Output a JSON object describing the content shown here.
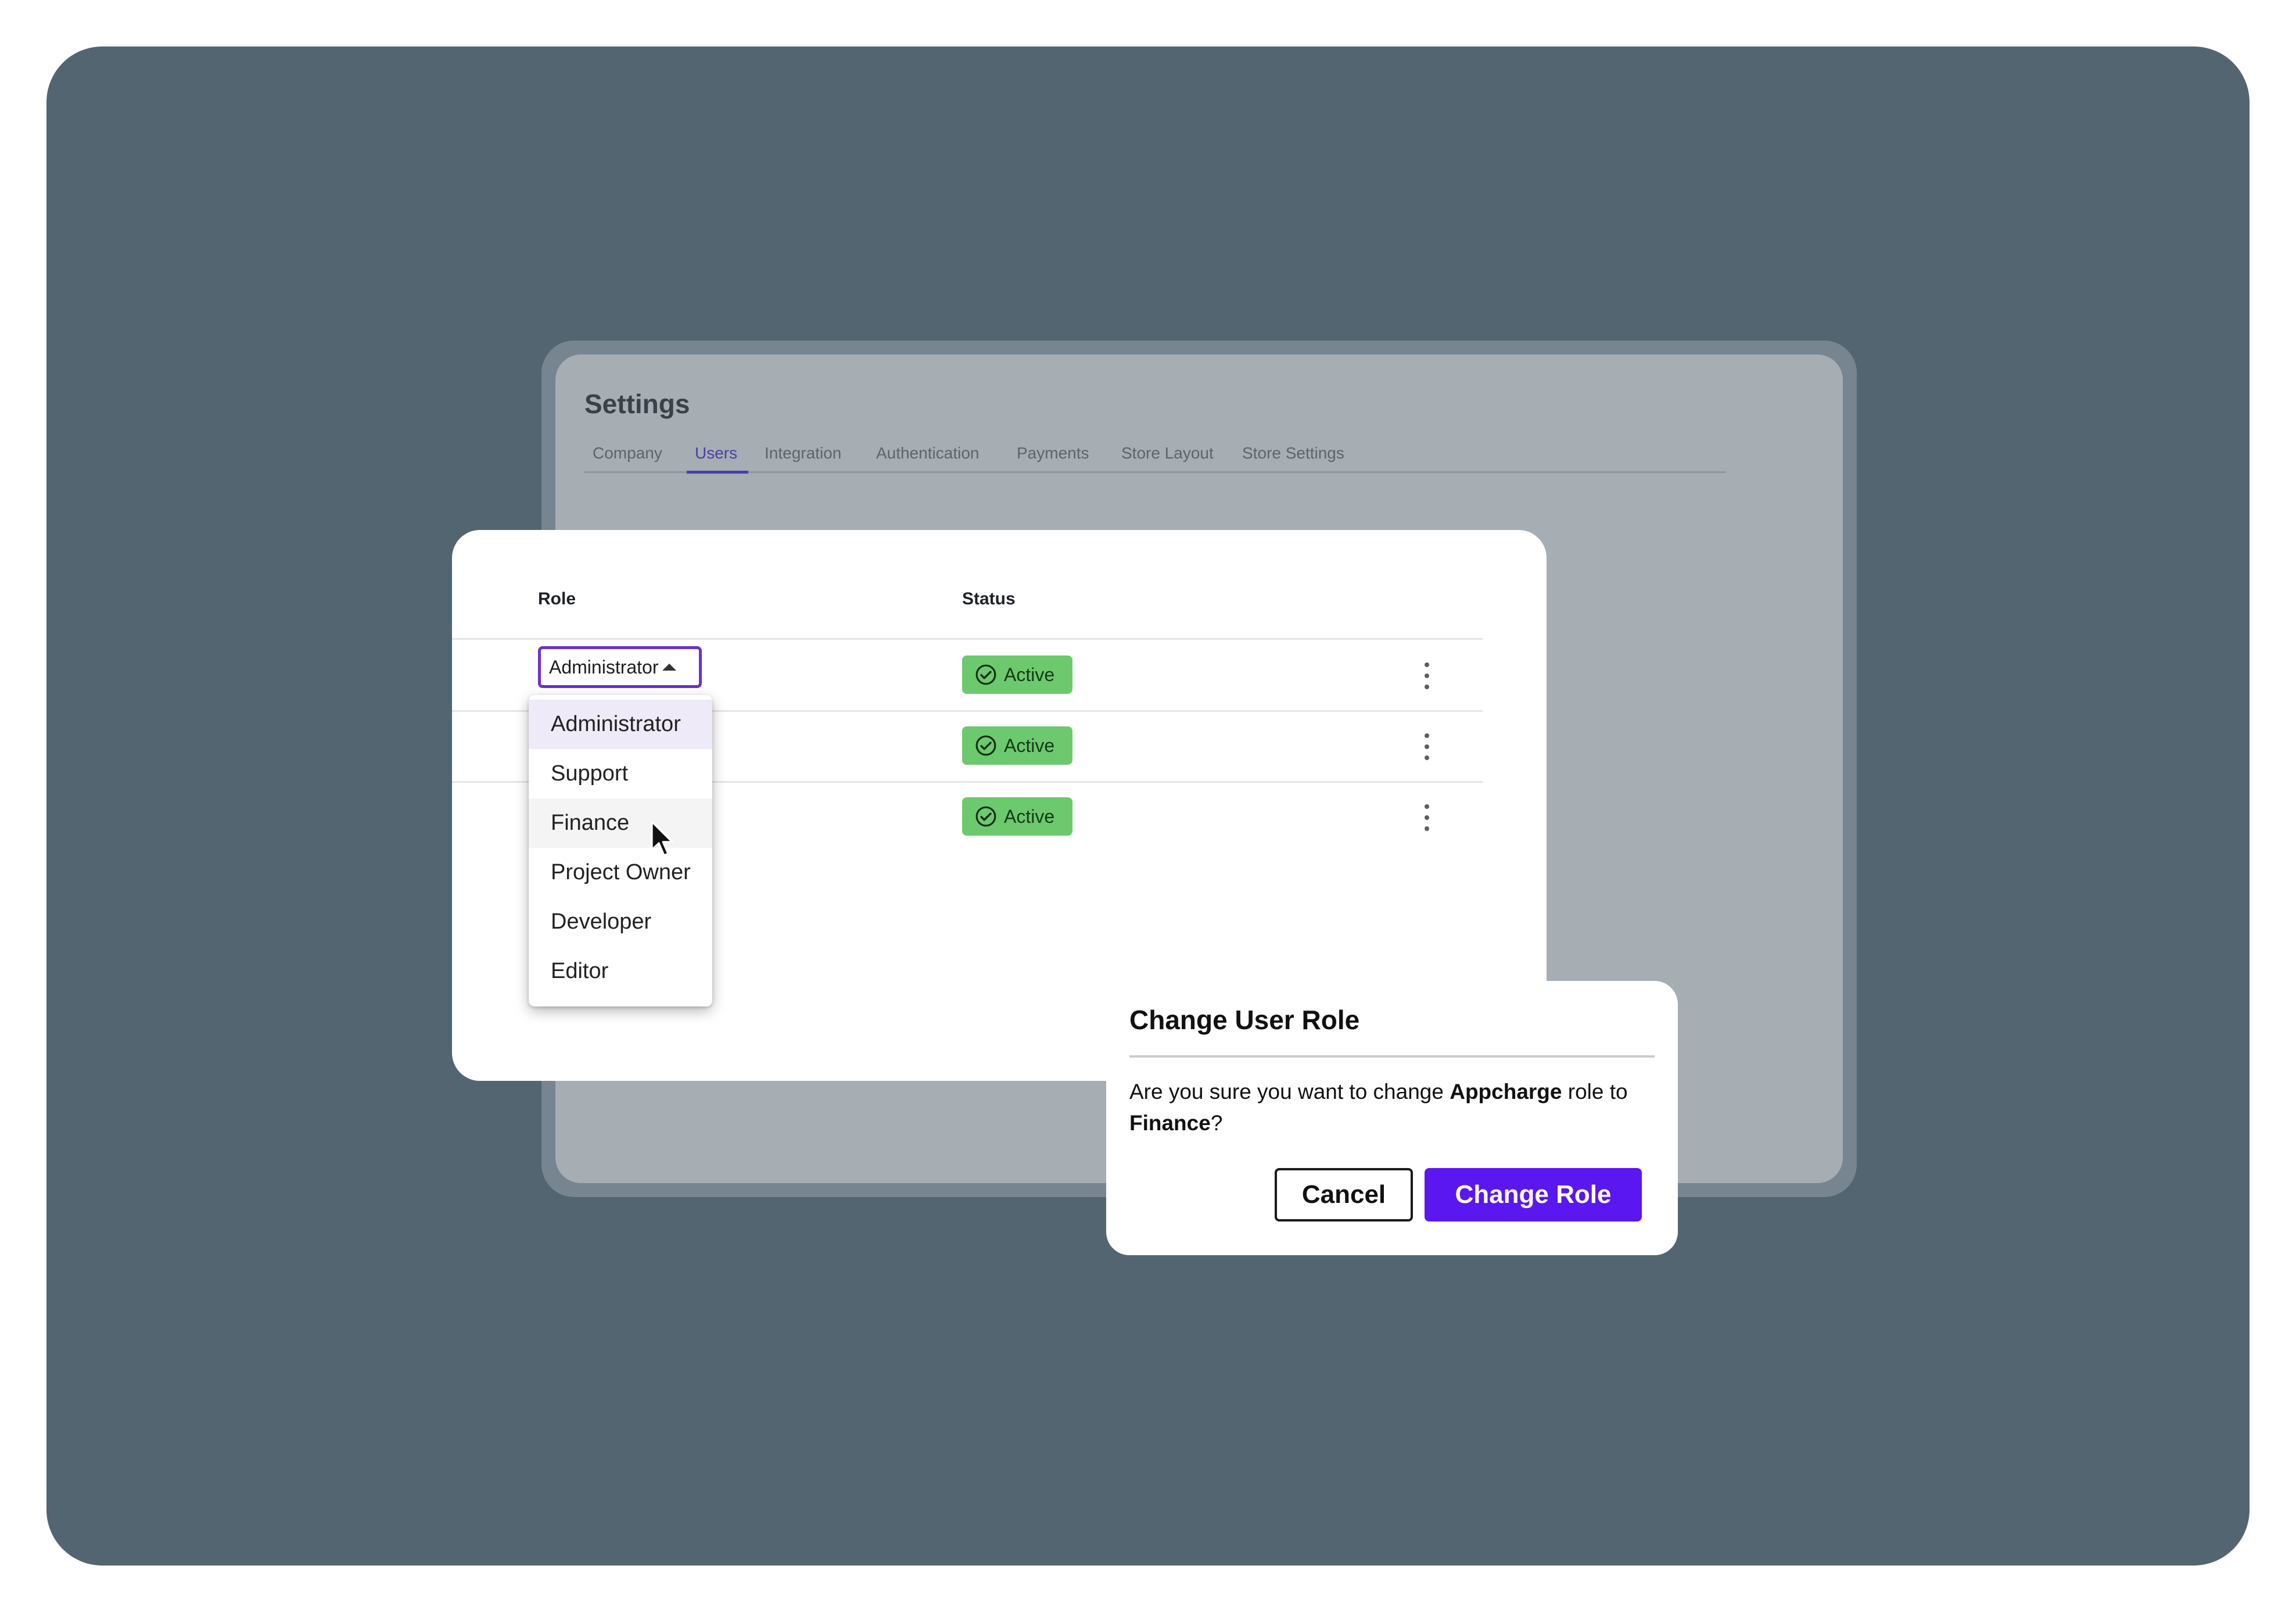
{
  "settings": {
    "title": "Settings",
    "tabs": [
      {
        "label": "Company"
      },
      {
        "label": "Users"
      },
      {
        "label": "Integration"
      },
      {
        "label": "Authentication"
      },
      {
        "label": "Payments"
      },
      {
        "label": "Store Layout"
      },
      {
        "label": "Store Settings"
      }
    ],
    "active_tab": "Users"
  },
  "table": {
    "columns": {
      "role": "Role",
      "status": "Status"
    },
    "role_select_value": "Administrator",
    "rows": [
      {
        "status": "Active"
      },
      {
        "status": "Active"
      },
      {
        "status": "Active"
      }
    ]
  },
  "role_dropdown": {
    "options": [
      "Administrator",
      "Support",
      "Finance",
      "Project Owner",
      "Developer",
      "Editor"
    ],
    "selected": "Administrator",
    "hovered": "Finance"
  },
  "dialog": {
    "title": "Change User Role",
    "body_prefix": "Are you sure you want to change ",
    "user_name": "Appcharge",
    "body_middle": " role to ",
    "new_role": "Finance",
    "body_suffix": "?",
    "cancel_label": "Cancel",
    "confirm_label": "Change Role"
  },
  "colors": {
    "backdrop": "#526571",
    "accent": "#5a17f0",
    "active_badge": "#6cc96e",
    "select_border": "#6a2fd6"
  },
  "icons": {
    "status": "check-circle-icon",
    "row_menu": "more-vertical-icon",
    "select_caret": "caret-up-icon",
    "pointer": "mouse-cursor-icon"
  }
}
